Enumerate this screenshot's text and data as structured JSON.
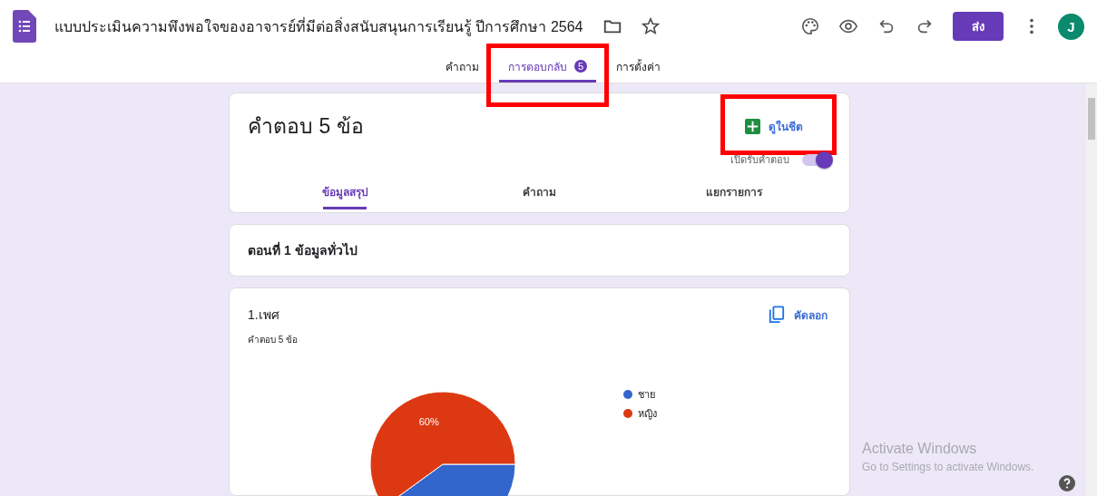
{
  "window": {
    "title": "แบบประเมินความพึงพอใจของอาจารย์ที่มีต่อสิ่งสนับสนุนการเรียนรู้ ปีการศึกษา 2564",
    "send_label": "ส่ง",
    "avatar": "J"
  },
  "tabs": [
    {
      "label": "คำถาม",
      "selected": false,
      "highlighted": false
    },
    {
      "label": "การตอบกลับ",
      "selected": true,
      "badge": "5",
      "highlighted": true
    },
    {
      "label": "การตั้งค่า",
      "selected": false,
      "highlighted": false
    }
  ],
  "responses": {
    "title": "คำตอบ 5 ข้อ",
    "sheet_button": {
      "label": "ดูในชีต",
      "highlighted": true
    },
    "accepting": {
      "label": "เปิดรับคำตอบ",
      "on": true
    },
    "subtabs": [
      {
        "label": "ข้อมูลสรุป",
        "selected": true
      },
      {
        "label": "คำถาม",
        "selected": false
      },
      {
        "label": "แยกรายการ",
        "selected": false
      }
    ]
  },
  "section": {
    "title": "ตอนที่ 1 ข้อมูลทั่วไป"
  },
  "question": {
    "title": "1.เพศ",
    "count": "คำตอบ 5 ข้อ",
    "copy_label": "คัดลอก",
    "chart_data": {
      "type": "pie",
      "categories": [
        "ชาย",
        "หญิง"
      ],
      "values": [
        40,
        60
      ],
      "colors": [
        "#3366cc",
        "#dc3912"
      ],
      "value_labels": [
        null,
        "60%"
      ],
      "legend": "right"
    }
  },
  "os_notice": {
    "title": "Activate Windows",
    "subtitle": "Go to Settings to activate Windows."
  }
}
